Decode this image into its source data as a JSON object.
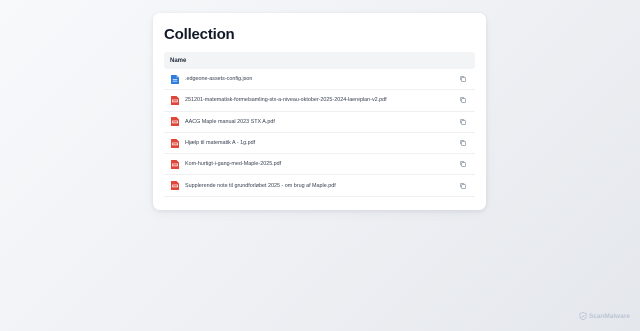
{
  "page": {
    "title": "Collection",
    "column_header": "Name"
  },
  "files": [
    {
      "name": ".edgeone-assets-config.json",
      "icon": "json-file-icon"
    },
    {
      "name": "251201-matematisk-formelsamling-stx-a-niveau-oktober-2025-2024-laereplan-v2.pdf",
      "icon": "pdf-file-icon"
    },
    {
      "name": "AACG Maple manual 2023 STX A.pdf",
      "icon": "pdf-file-icon"
    },
    {
      "name": "Hjælp til matematik A - 1g.pdf",
      "icon": "pdf-file-icon"
    },
    {
      "name": "Kom-hurtigt-i-gang-med-Maple-2025.pdf",
      "icon": "pdf-file-icon"
    },
    {
      "name": "Supplerende note til grundforløbet 2025 - om brug af Maple.pdf",
      "icon": "pdf-file-icon"
    }
  ],
  "row_action_icon": "copy-icon",
  "branding": {
    "text": "ScanMalware",
    "icon": "shield-logo-icon"
  },
  "colors": {
    "pdf_icon": "#e0453a",
    "json_icon": "#2f7de0",
    "title": "#111827",
    "header_bg": "#f3f4f6"
  }
}
